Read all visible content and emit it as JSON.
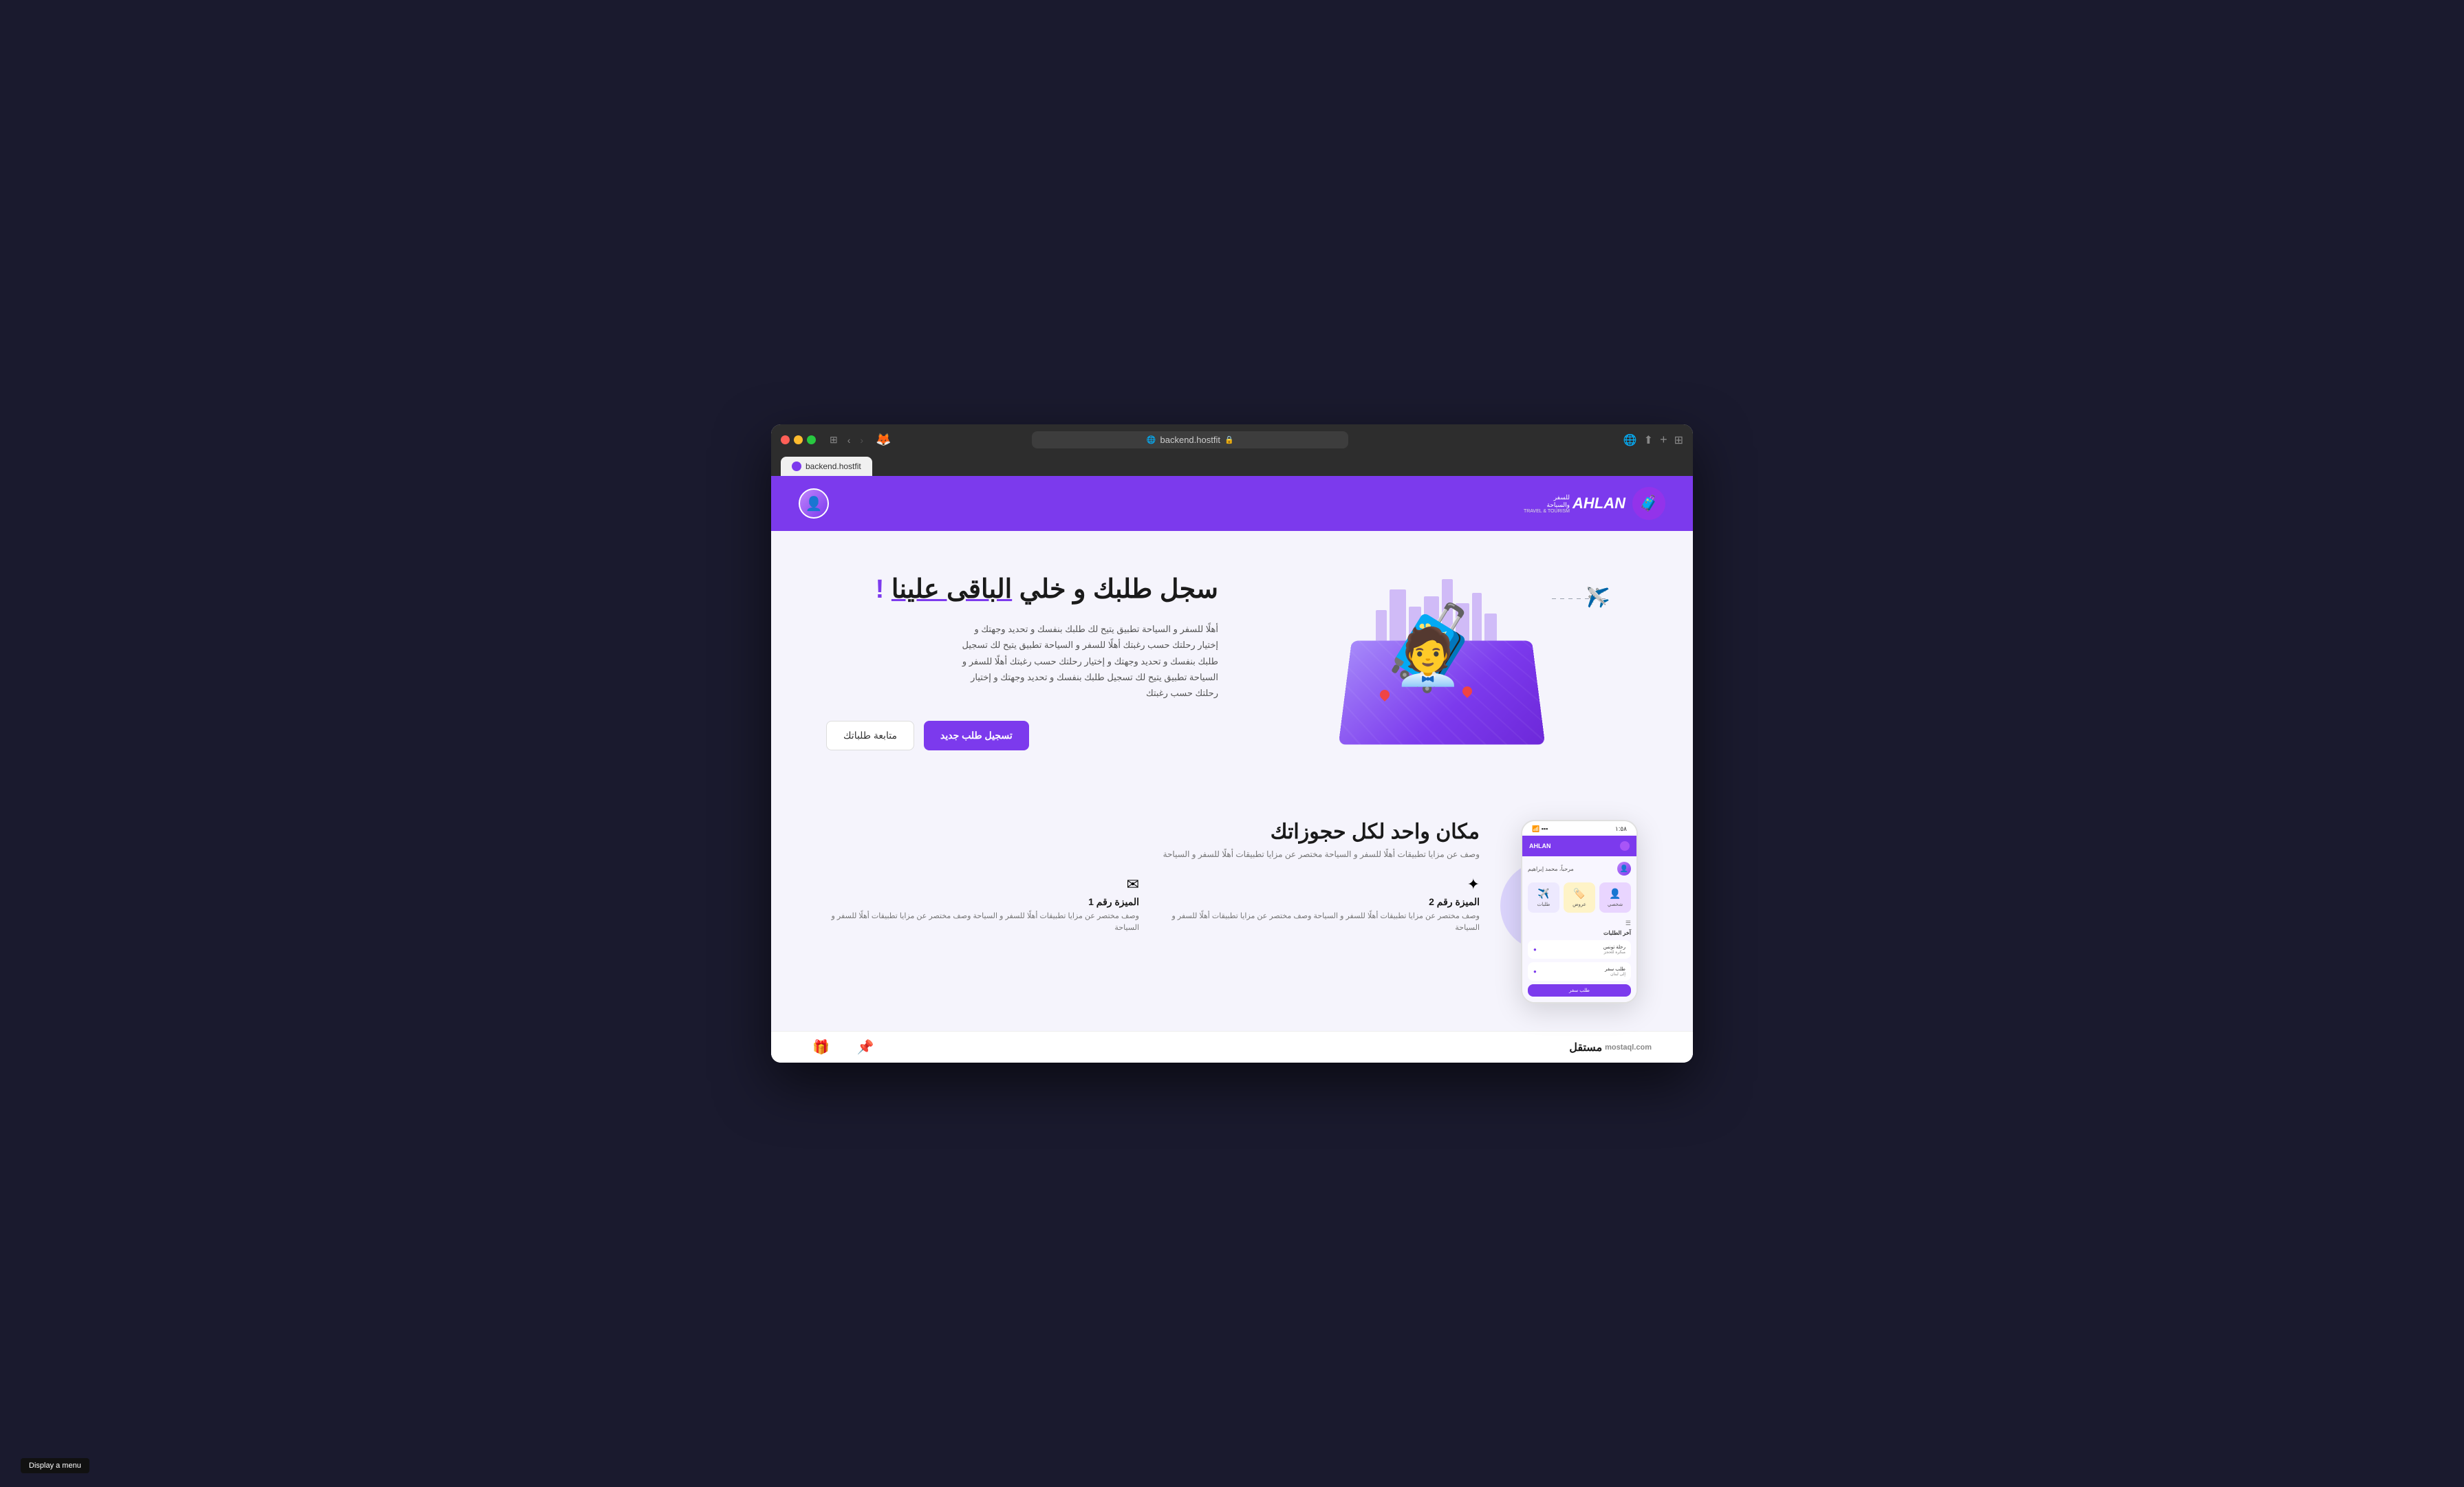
{
  "browser": {
    "traffic_lights": [
      "red",
      "yellow",
      "green"
    ],
    "url": "backend.hostfit",
    "tab_label": "backend.hostfit",
    "back_icon": "‹",
    "forward_icon": "›",
    "share_icon": "⬆",
    "new_tab_icon": "+",
    "bookmark_icon": "⧉"
  },
  "site": {
    "header": {
      "logo_text": "AHLAN",
      "logo_subtitle_line1": "للسفر",
      "logo_subtitle_line2": "والسياحة",
      "logo_subtitle_line3": "TRAVEL & TOURISM"
    },
    "hero": {
      "title_part1": "سجل طلبك و خلي",
      "title_underlined": "الباقى علينا",
      "title_exclaim": "!",
      "description": "أهلًا للسفر و السياحة تطبيق يتيح لك طلبك بنفسك و تحديد وجهتك و إختيار رحلتك حسب رغبتك أهلًا للسفر و السياحة تطبيق يتيح لك تسجيل طلبك بنفسك و تحديد وجهتك و إختيار رحلتك حسب رغبتك أهلًا للسفر و السياحة تطبيق يتيح لك تسجيل طلبك بنفسك و تحديد وجهتك و إختيار رحلتك حسب رغبتك",
      "btn_primary": "تسجيل طلب جديد",
      "btn_secondary": "متابعة طلباتك"
    },
    "lower": {
      "phone": {
        "status_time": "١:٥٨",
        "greeting": "مرحباً، محمد إبراهيم",
        "icon1_label": "شخصي",
        "icon2_label": "عروض",
        "icon3_label": "طلبات",
        "section_label": "آخر الطلبات",
        "trip1_name": "رحلة تونس",
        "trip1_sub": "مبكرة للحجز",
        "trip2_sub": "طلب سفر",
        "trip2_name": "إلى لبنان",
        "cta_label": "طلب سفر"
      },
      "features": {
        "title": "مكان واحد لكل حجوزاتك",
        "subtitle": "وصف عن مزايا تطبيقات أهلًا للسفر و السياحة مختصر عن مزايا تطبيقات أهلًا للسفر و السياحة",
        "items": [
          {
            "icon": "✦",
            "name": "الميزة رقم 2",
            "desc": "وصف مختصر عن مزايا تطبيقات أهلًا للسفر و السياحة وصف مختصر عن مزايا تطبيقات أهلًا للسفر و السياحة"
          },
          {
            "icon": "✉",
            "name": "الميزة رقم 1",
            "desc": "وصف مختصر عن مزايا تطبيقات أهلًا للسفر و السياحة وصف مختصر عن مزايا تطبيقات أهلًا للسفر و السياحة"
          }
        ]
      }
    },
    "bottom_nav": {
      "logo": "مستقل",
      "logo_en": "mostaql.com",
      "icons": [
        "🎁",
        "📌"
      ]
    }
  },
  "tooltip": {
    "text": "Display a menu"
  }
}
